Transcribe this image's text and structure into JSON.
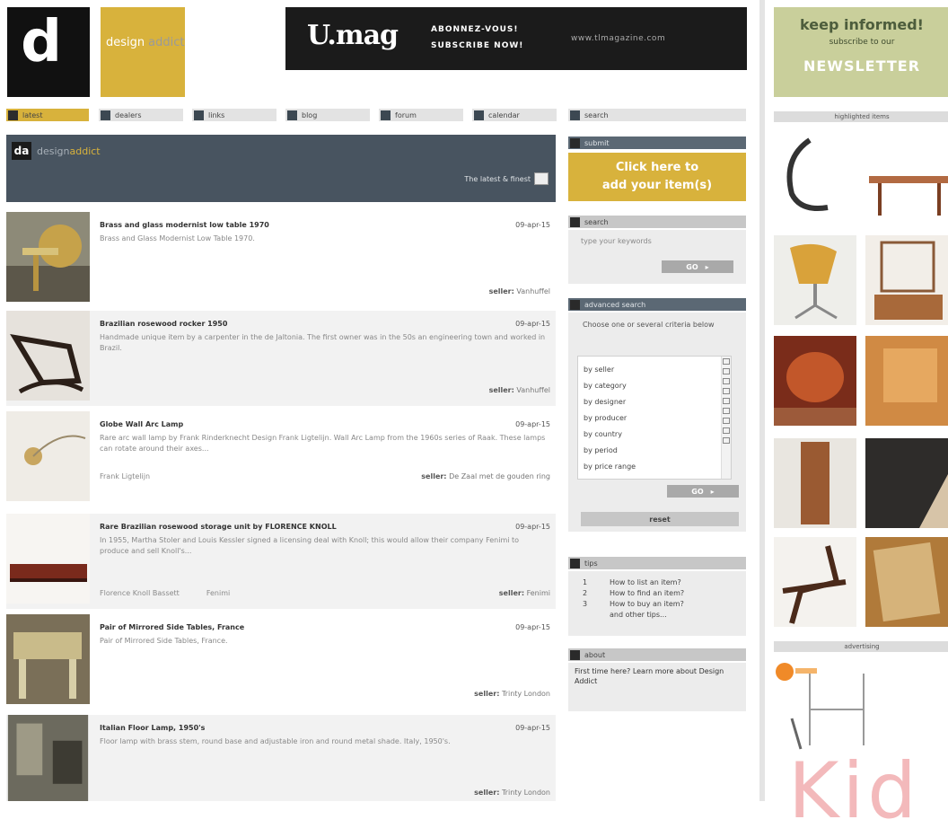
{
  "header": {
    "logo_mark": "d",
    "brand_part1": "design",
    "brand_part2": "addict",
    "banner": {
      "logo": "U.mag",
      "cta_line1": "ABONNEZ-VOUS!",
      "cta_line2": "SUBSCRIBE NOW!",
      "url": "www.tlmagazine.com"
    }
  },
  "nav": [
    "latest",
    "dealers",
    "links",
    "blog",
    "forum",
    "calendar"
  ],
  "hero": {
    "title_a": "design",
    "title_b": "addict",
    "sort_label": "The latest & finest"
  },
  "listings": [
    {
      "title": "Brass and glass modernist low table 1970",
      "date": "09-apr-15",
      "desc": "Brass and Glass Modernist Low Table 1970.",
      "seller_label": "seller:",
      "seller": "Vanhuffel"
    },
    {
      "title": "Brazilian rosewood rocker 1950",
      "date": "09-apr-15",
      "desc": "Handmade unique item by a carpenter in the de Jaltonia. The first owner was in the 50s an engineering town and worked in Brazil.",
      "seller_label": "seller:",
      "seller": "Vanhuffel"
    },
    {
      "title": "Globe Wall Arc Lamp",
      "date": "09-apr-15",
      "desc": "Rare arc wall lamp by Frank Rinderknecht Design Frank Ligtelijn. Wall Arc Lamp from the 1960s series of Raak. These lamps can rotate around their axes...",
      "extra": [
        "Frank Ligtelijn"
      ],
      "seller_label": "seller:",
      "seller": "De Zaal met de gouden ring"
    },
    {
      "title": "Rare Brazilian rosewood storage unit by FLORENCE KNOLL",
      "date": "09-apr-15",
      "desc": "In 1955, Martha Stoler and Louis Kessler signed a licensing deal with Knoll; this would allow their company Fenimi to produce and sell Knoll's...",
      "extra": [
        "Florence Knoll Bassett",
        "Fenimi"
      ],
      "seller_label": "seller:",
      "seller": "Fenimi"
    },
    {
      "title": "Pair of Mirrored Side Tables, France",
      "date": "09-apr-15",
      "desc": "Pair of Mirrored Side Tables, France.",
      "seller_label": "seller:",
      "seller": "Trinty London"
    },
    {
      "title": "Italian Floor Lamp, 1950's",
      "date": "09-apr-15",
      "desc": "Floor lamp with brass stem, round base and adjustable iron and round metal shade. Italy, 1950's.",
      "seller_label": "seller:",
      "seller": "Trinty London"
    }
  ],
  "middle": {
    "search_tab": "search",
    "submit_label": "submit",
    "submit_cta_line1": "Click here to",
    "submit_cta_line2": "add your item(s)",
    "search_label": "search",
    "keywords_placeholder": "type your keywords",
    "go": "GO",
    "advanced_label": "advanced search",
    "advanced_hint": "Choose one or several criteria below",
    "criteria": [
      "by seller",
      "by category",
      "by designer",
      "by producer",
      "by country",
      "by period",
      "by price range"
    ],
    "reset": "reset",
    "tips_label": "tips",
    "tips": [
      {
        "n": "1",
        "text": "How to list an item?"
      },
      {
        "n": "2",
        "text": "How to find an item?"
      },
      {
        "n": "3",
        "text": "How to buy an item?"
      },
      {
        "n": "",
        "text": "and other tips..."
      }
    ],
    "about_label": "about",
    "about_text": "First time here? Learn more about Design Addict"
  },
  "right": {
    "nl_line1": "keep informed!",
    "nl_line2": "subscribe to our",
    "nl_line3": "NEWSLETTER",
    "highlights_label": "highlighted items",
    "advertising_label": "advertising",
    "watermark": "Kid"
  },
  "colors": {
    "accent": "#d8b23c",
    "dark_bar": "#485460",
    "newsletter": "#c9cf9b"
  }
}
